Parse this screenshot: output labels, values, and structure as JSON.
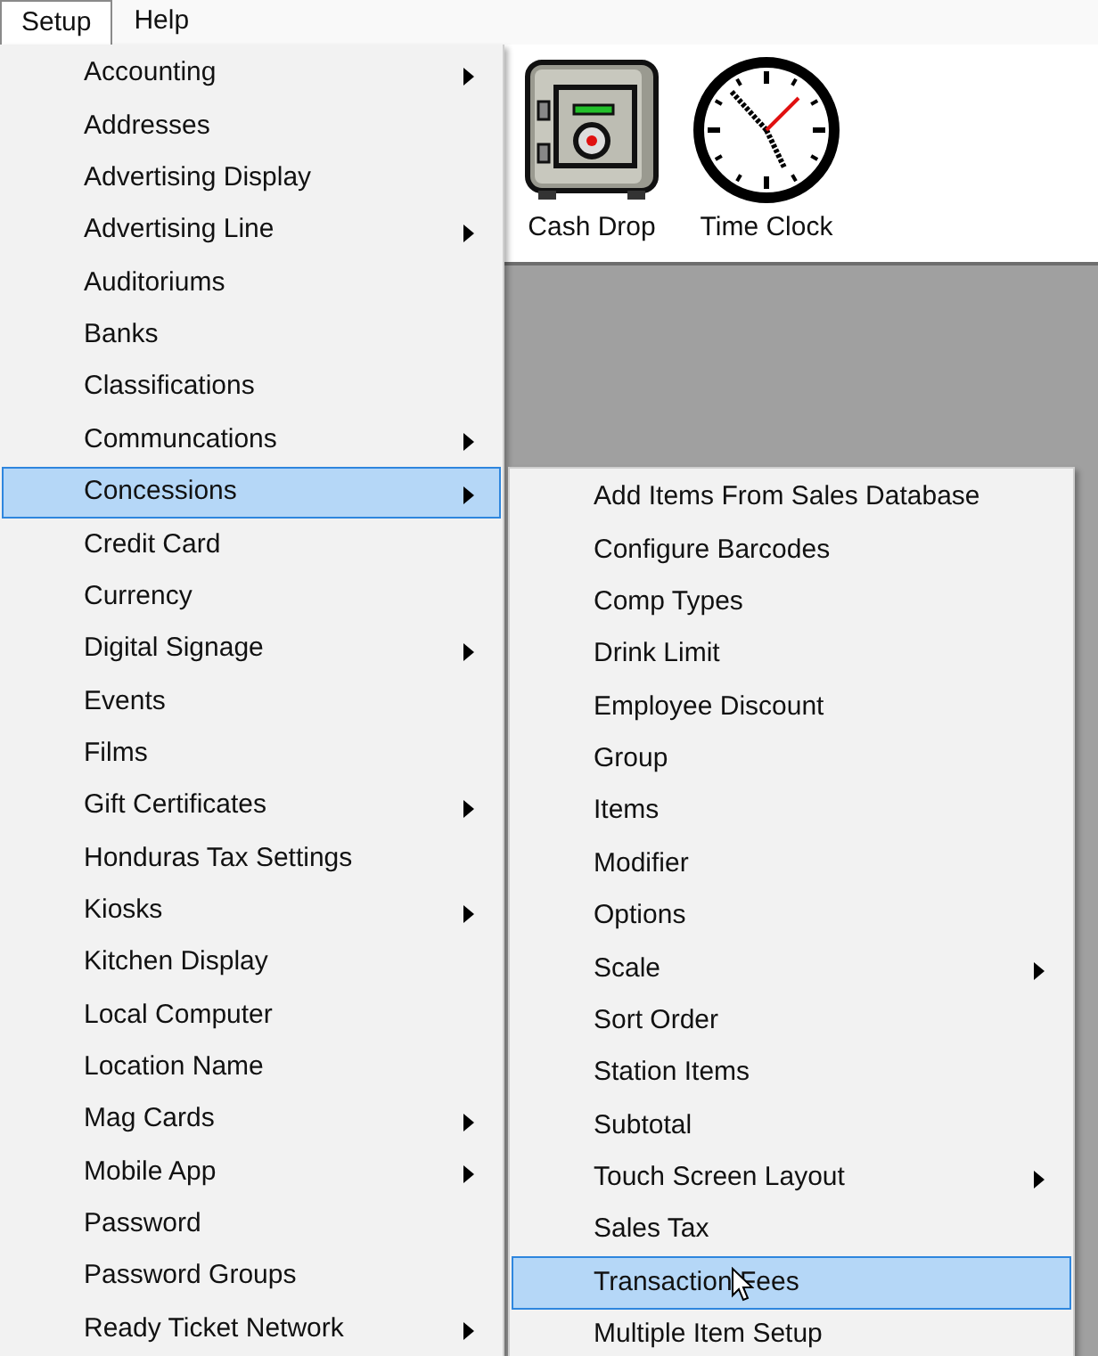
{
  "menubar": [
    {
      "label": "Setup",
      "selected": true
    },
    {
      "label": "Help",
      "selected": false
    }
  ],
  "toolbar": [
    {
      "label": "Cash Drop",
      "kind": "safe"
    },
    {
      "label": "Time Clock",
      "kind": "clock"
    }
  ],
  "setup_menu": [
    {
      "label": "Accounting",
      "has_submenu": true,
      "selected": false
    },
    {
      "label": "Addresses",
      "has_submenu": false,
      "selected": false
    },
    {
      "label": "Advertising Display",
      "has_submenu": false,
      "selected": false
    },
    {
      "label": "Advertising Line",
      "has_submenu": true,
      "selected": false
    },
    {
      "label": "Auditoriums",
      "has_submenu": false,
      "selected": false
    },
    {
      "label": "Banks",
      "has_submenu": false,
      "selected": false
    },
    {
      "label": "Classifications",
      "has_submenu": false,
      "selected": false
    },
    {
      "label": "Communcations",
      "has_submenu": true,
      "selected": false
    },
    {
      "label": "Concessions",
      "has_submenu": true,
      "selected": true
    },
    {
      "label": "Credit Card",
      "has_submenu": false,
      "selected": false
    },
    {
      "label": "Currency",
      "has_submenu": false,
      "selected": false
    },
    {
      "label": "Digital Signage",
      "has_submenu": true,
      "selected": false
    },
    {
      "label": "Events",
      "has_submenu": false,
      "selected": false
    },
    {
      "label": "Films",
      "has_submenu": false,
      "selected": false
    },
    {
      "label": "Gift Certificates",
      "has_submenu": true,
      "selected": false
    },
    {
      "label": "Honduras Tax Settings",
      "has_submenu": false,
      "selected": false
    },
    {
      "label": "Kiosks",
      "has_submenu": true,
      "selected": false
    },
    {
      "label": "Kitchen Display",
      "has_submenu": false,
      "selected": false
    },
    {
      "label": "Local Computer",
      "has_submenu": false,
      "selected": false
    },
    {
      "label": "Location Name",
      "has_submenu": false,
      "selected": false
    },
    {
      "label": "Mag Cards",
      "has_submenu": true,
      "selected": false
    },
    {
      "label": "Mobile App",
      "has_submenu": true,
      "selected": false
    },
    {
      "label": "Password",
      "has_submenu": false,
      "selected": false
    },
    {
      "label": "Password Groups",
      "has_submenu": false,
      "selected": false
    },
    {
      "label": "Ready Ticket Network",
      "has_submenu": true,
      "selected": false
    }
  ],
  "concessions_submenu": [
    {
      "label": "Add Items From Sales Database",
      "has_submenu": false,
      "selected": false
    },
    {
      "label": "Configure Barcodes",
      "has_submenu": false,
      "selected": false
    },
    {
      "label": "Comp Types",
      "has_submenu": false,
      "selected": false
    },
    {
      "label": "Drink Limit",
      "has_submenu": false,
      "selected": false
    },
    {
      "label": "Employee Discount",
      "has_submenu": false,
      "selected": false
    },
    {
      "label": "Group",
      "has_submenu": false,
      "selected": false
    },
    {
      "label": "Items",
      "has_submenu": false,
      "selected": false
    },
    {
      "label": "Modifier",
      "has_submenu": false,
      "selected": false
    },
    {
      "label": "Options",
      "has_submenu": false,
      "selected": false
    },
    {
      "label": "Scale",
      "has_submenu": true,
      "selected": false
    },
    {
      "label": "Sort Order",
      "has_submenu": false,
      "selected": false
    },
    {
      "label": "Station Items",
      "has_submenu": false,
      "selected": false
    },
    {
      "label": "Subtotal",
      "has_submenu": false,
      "selected": false
    },
    {
      "label": "Touch Screen Layout",
      "has_submenu": true,
      "selected": false
    },
    {
      "label": "Sales Tax",
      "has_submenu": false,
      "selected": false
    },
    {
      "label": "Transaction Fees",
      "has_submenu": false,
      "selected": true
    },
    {
      "label": "Multiple Item Setup",
      "has_submenu": false,
      "selected": false
    }
  ]
}
